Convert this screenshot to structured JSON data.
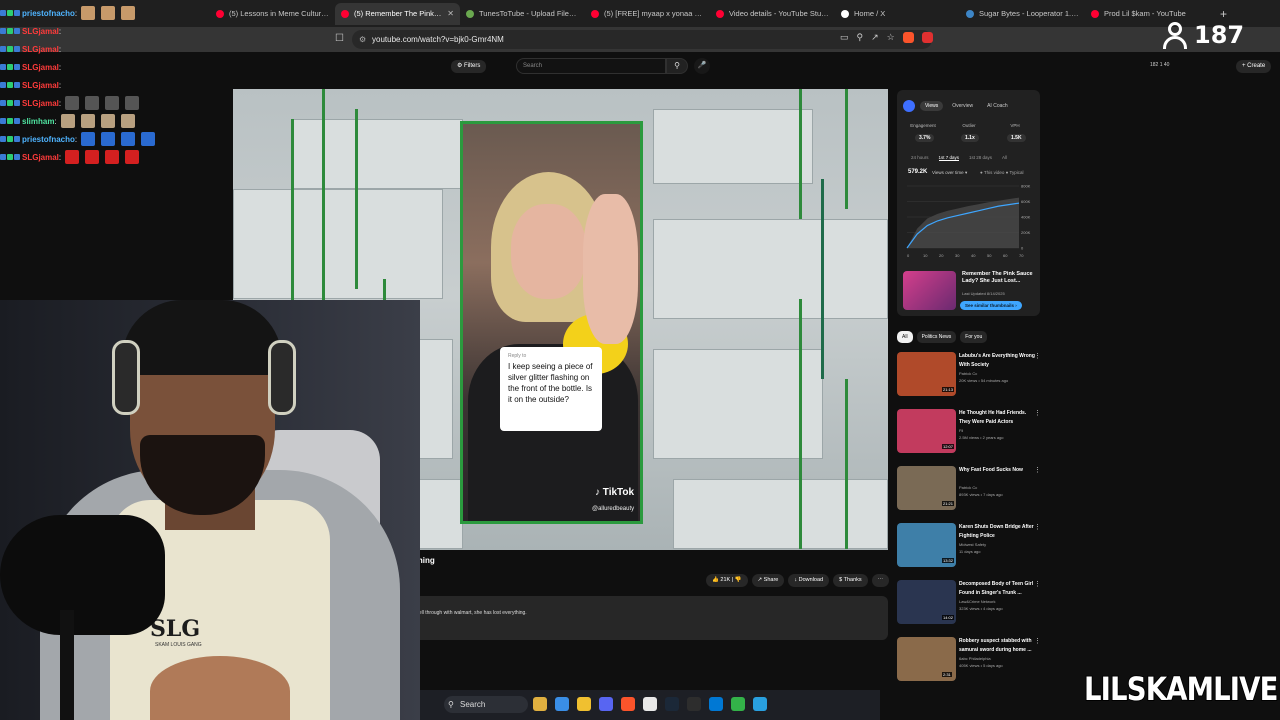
{
  "browser": {
    "tabs": [
      {
        "title": "(5) Lessons in Meme Culture - YouTube",
        "favicon_color": "#ff0033",
        "active": false
      },
      {
        "title": "(5) Remember The Pink Sauce",
        "favicon_color": "#ff0033",
        "active": true
      },
      {
        "title": "TunesToTube - Upload Files - Logged in",
        "favicon_color": "#6aa84f",
        "active": false
      },
      {
        "title": "(5) [FREE] myaap x yonaa x lowend",
        "favicon_color": "#ff0033",
        "active": false
      },
      {
        "title": "Video details - YouTube Studio",
        "favicon_color": "#ff0033",
        "active": false
      },
      {
        "title": "Home / X",
        "favicon_color": "#ffffff",
        "active": false
      },
      {
        "title": "Sugar Bytes - Looperator 1.0.1 R2",
        "favicon_color": "#3d85c6",
        "active": false
      },
      {
        "title": "Prod Lil $kam - YouTube",
        "favicon_color": "#ff0033",
        "active": false
      }
    ],
    "new_tab_label": "+",
    "url": "youtube.com/watch?v=bjk0-Gmr4NM"
  },
  "youtube": {
    "filters_label": "Filters",
    "search_placeholder": "Search",
    "header_stats": "182  1  40",
    "create_label": "+ Create"
  },
  "video": {
    "caption_reply": "Reply to",
    "caption_text": "I keep seeing a piece of silver glitter flashing on the front of the bottle. Is it on the outside?",
    "tiktok_logo": "TikTok",
    "tiktok_handle": "@alluredbeauty",
    "title": "st Lost Everything",
    "actions": {
      "like": "21K",
      "share": "Share",
      "download": "Download",
      "thanks": "Thanks"
    },
    "description": "her deal fell through with walmart, she has lost everything."
  },
  "analytics": {
    "tabs": [
      "Views",
      "Overview",
      "AI Coach"
    ],
    "metrics": [
      {
        "label": "Engagement",
        "value": "3.7%"
      },
      {
        "label": "Outlier",
        "value": "1.1x"
      },
      {
        "label": "VPH",
        "value": "1.5K"
      }
    ],
    "ranges": [
      "24 hours",
      "1st 7 days",
      "1st 28 days",
      "All"
    ],
    "views_total": "579.2K",
    "views_label": "Views over time",
    "legend": "● This video  ● Typical",
    "chart_y_ticks": [
      "800K",
      "600K",
      "400K",
      "200K",
      "0"
    ],
    "chart_x_ticks": [
      "0",
      "10",
      "20",
      "30",
      "40",
      "50",
      "60",
      "70"
    ],
    "series_this_video": [
      0,
      180,
      290,
      350,
      390,
      420,
      450,
      480,
      510,
      540,
      560,
      579.2
    ],
    "series_typical": [
      0,
      250,
      380,
      440,
      480,
      510,
      540,
      565,
      590,
      610,
      630,
      650
    ],
    "video_title": "Remember The Pink Sauce Lady? She Just Lost...",
    "video_sub": "Last Updated 8/14/2025",
    "similar_label": "See similar thumbnails"
  },
  "recommendations": {
    "chips": [
      "All",
      "Politics News",
      "For you"
    ],
    "items": [
      {
        "title": "Labubu's Are Everything Wrong With Society",
        "channel": "Patrick Cc",
        "meta": "20K views • 54 minutes ago",
        "duration": "21:13",
        "thumb": "#b04a2a"
      },
      {
        "title": "He Thought He Had Friends. They Were Paid Actors",
        "channel": "Fil",
        "meta": "2.5M views • 2 years ago",
        "duration": "12:07",
        "thumb": "#c23b5e"
      },
      {
        "title": "Why Fast Food Sucks Now",
        "channel": "Patrick Cc",
        "meta": "893K views • 7 days ago",
        "duration": "21:21",
        "thumb": "#7a6a55"
      },
      {
        "title": "Karen Shuts Down Bridge After Fighting Police",
        "channel": "Midwest Safety",
        "meta": "11 days ago",
        "duration": "13:32",
        "thumb": "#3e7fa8"
      },
      {
        "title": "Decomposed Body of Teen Girl Found in Singer's Trunk ...",
        "channel": "Law&Crime Network",
        "meta": "323K views • 4 days ago",
        "duration": "14:02",
        "thumb": "#2a3550"
      },
      {
        "title": "Robbery suspect stabbed with samurai sword during home ...",
        "channel": "6abc Philadelphia",
        "meta": "405K views • 5 days ago",
        "duration": "2:31",
        "thumb": "#8a6a4a"
      }
    ]
  },
  "taskbar": {
    "search_label": "Search",
    "app_colors": [
      "#e0b040",
      "#3a8ee6",
      "#f0c030",
      "#5865f2",
      "#fb542b",
      "#e8e8e8",
      "#1b2838",
      "#2d2d2d",
      "#0078d4",
      "#33b249",
      "#29a0e0"
    ]
  },
  "chat": [
    {
      "user": "priestofnacho",
      "color": "#4fb4ff",
      "emotes": [
        "#c79a6a",
        "#c79a6a",
        "#c79a6a"
      ]
    },
    {
      "user": "SLGjamal",
      "color": "#ff3b3b",
      "emotes": []
    },
    {
      "user": "SLGjamal",
      "color": "#ff3b3b",
      "emotes": []
    },
    {
      "user": "SLGjamal",
      "color": "#ff3b3b",
      "emotes": []
    },
    {
      "user": "SLGjamal",
      "color": "#ff3b3b",
      "emotes": []
    },
    {
      "user": "SLGjamal",
      "color": "#ff3b3b",
      "emotes": [
        "#555555",
        "#555555",
        "#555555",
        "#555555"
      ]
    },
    {
      "user": "slimham",
      "color": "#4fe3a0",
      "emotes": [
        "#b8a080",
        "#b8a080",
        "#b8a080",
        "#b8a080"
      ]
    },
    {
      "user": "priestofnacho",
      "color": "#4fb4ff",
      "emotes": [
        "#2a6ad0",
        "#2a6ad0",
        "#2a6ad0",
        "#2a6ad0"
      ]
    },
    {
      "user": "SLGjamal",
      "color": "#ff3b3b",
      "emotes": [
        "#d42020",
        "#d42020",
        "#d42020",
        "#d42020"
      ]
    }
  ],
  "stream": {
    "viewer_count": "187",
    "watermark": "LILSKAMLIVE",
    "tee_logo": "SLG",
    "tee_sub": "SKAM LOUIS GANG"
  }
}
